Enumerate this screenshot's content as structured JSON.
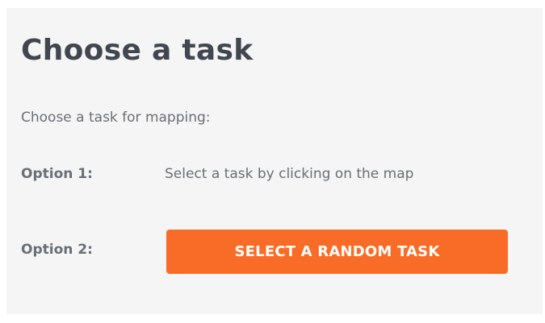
{
  "panel": {
    "title": "Choose a task",
    "intro": "Choose a task for mapping:",
    "option1": {
      "label": "Option 1:",
      "text": "Select a task by clicking on the map"
    },
    "option2": {
      "label": "Option 2:",
      "button_label": "SELECT A RANDOM TASK"
    }
  },
  "colors": {
    "accent": "#f96c27",
    "title": "#414650",
    "text": "#6a6e75",
    "panel_bg": "#f5f5f5"
  }
}
